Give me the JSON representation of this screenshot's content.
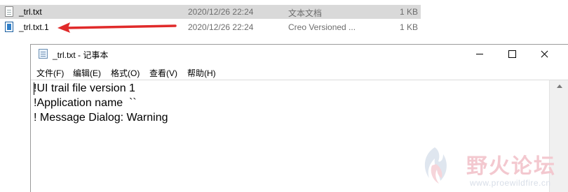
{
  "files": [
    {
      "name": "_trl.txt",
      "date": "2020/12/26 22:24",
      "type": "文本文档",
      "size": "1 KB",
      "icon": "text-file-icon",
      "selected": true
    },
    {
      "name": "_trl.txt.1",
      "date": "2020/12/26 22:24",
      "type": "Creo Versioned ...",
      "size": "1 KB",
      "icon": "creo-file-icon",
      "selected": false
    }
  ],
  "annotation": {
    "arrow_color": "#e02a2a"
  },
  "notepad": {
    "title": "_trl.txt - 记事本",
    "menu": [
      "文件(F)",
      "编辑(E)",
      "格式(O)",
      "查看(V)",
      "帮助(H)"
    ],
    "lines": [
      "!UI trail file version 1",
      "!Application name  ``",
      "! Message Dialog: Warning"
    ]
  },
  "watermark": {
    "brand": "野火论坛",
    "url": "www.proewildfire.cn",
    "brand_color": "#f3c8cf"
  }
}
